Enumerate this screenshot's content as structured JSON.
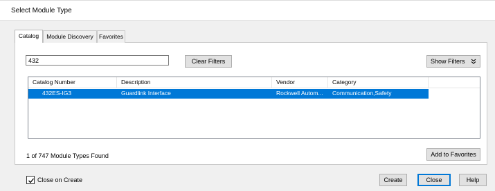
{
  "window": {
    "title": "Select Module Type"
  },
  "tabs": [
    {
      "label": "Catalog",
      "active": true
    },
    {
      "label": "Module Discovery",
      "active": false
    },
    {
      "label": "Favorites",
      "active": false
    }
  ],
  "search": {
    "value": "432",
    "placeholder": ""
  },
  "filters": {
    "clear_label": "Clear Filters",
    "show_label": "Show Filters",
    "show_icon": "double-chevron-down-icon"
  },
  "table": {
    "columns": [
      "Catalog Number",
      "Description",
      "Vendor",
      "Category"
    ],
    "rows": [
      {
        "catalog_number": "432ES-IG3",
        "description": "Guardlink Interface",
        "vendor": "Rockwell Autom...",
        "category": "Communication,Safety",
        "selected": true
      }
    ],
    "selection_color": "#0078d7"
  },
  "status": {
    "found_text": "1 of 747 Module Types Found"
  },
  "favorites": {
    "add_label": "Add to Favorites"
  },
  "footer": {
    "close_on_create_label": "Close on Create",
    "close_on_create_checked": true,
    "create_label": "Create",
    "close_label": "Close",
    "help_label": "Help"
  }
}
